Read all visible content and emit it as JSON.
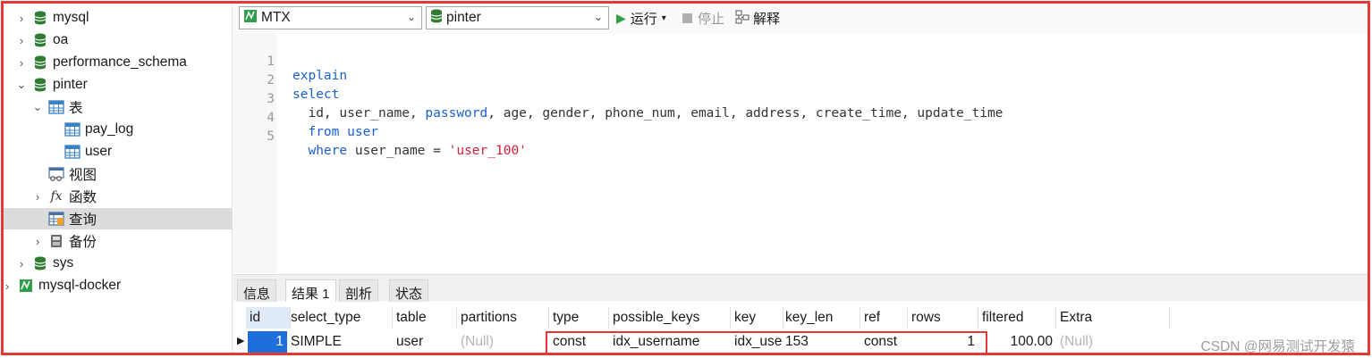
{
  "sidebar": {
    "items": [
      {
        "label": "mysql",
        "icon": "database-icon"
      },
      {
        "label": "oa",
        "icon": "database-icon"
      },
      {
        "label": "performance_schema",
        "icon": "database-icon"
      },
      {
        "label": "pinter",
        "icon": "database-icon",
        "expanded": true
      },
      {
        "label": "表",
        "icon": "table-group-icon",
        "expanded": true
      },
      {
        "label": "pay_log",
        "icon": "table-icon"
      },
      {
        "label": "user",
        "icon": "table-icon"
      },
      {
        "label": "视图",
        "icon": "view-icon"
      },
      {
        "label": "函数",
        "icon": "function-icon"
      },
      {
        "label": "查询",
        "icon": "query-icon",
        "selected": true
      },
      {
        "label": "备份",
        "icon": "backup-icon"
      },
      {
        "label": "sys",
        "icon": "database-icon"
      },
      {
        "label": "mysql-docker",
        "icon": "connection-icon"
      }
    ]
  },
  "toolbar": {
    "connection": "MTX",
    "database": "pinter",
    "run_label": "运行",
    "stop_label": "停止",
    "explain_label": "解释"
  },
  "editor": {
    "lines": [
      {
        "num": "1",
        "t1": "explain",
        "t2": "",
        "t3": "",
        "t4": "",
        "t5": ""
      },
      {
        "num": "2",
        "t1": "select",
        "t2": "",
        "t3": "",
        "t4": "",
        "t5": ""
      },
      {
        "num": "3",
        "t1": "  id, user_name, ",
        "t2": "password",
        "t3": ", age, gender, phone_num, email, address, create_time, update_time",
        "t4": "",
        "t5": ""
      },
      {
        "num": "4",
        "t1": "  from user",
        "t2": "",
        "t3": "",
        "t4": "",
        "t5": ""
      },
      {
        "num": "5",
        "t1": "  where",
        "t2": " user_name = ",
        "t3": "'user_100'",
        "t4": "",
        "t5": ""
      }
    ]
  },
  "result_tabs": [
    "信息",
    "结果 1",
    "剖析",
    "状态"
  ],
  "grid": {
    "headers": [
      "id",
      "select_type",
      "table",
      "partitions",
      "type",
      "possible_keys",
      "key",
      "key_len",
      "ref",
      "rows",
      "filtered",
      "Extra"
    ],
    "row": [
      "1",
      "SIMPLE",
      "user",
      "(Null)",
      "const",
      "idx_username",
      "idx_use",
      "153",
      "const",
      "1",
      "100.00",
      "(Null)"
    ]
  },
  "watermark": "CSDN @网易测试开发猿",
  "colors": {
    "highlight": "#e53935",
    "keyword": "#1a5fd4",
    "string": "#d61f3a",
    "db_icon": "#2e7d32"
  }
}
